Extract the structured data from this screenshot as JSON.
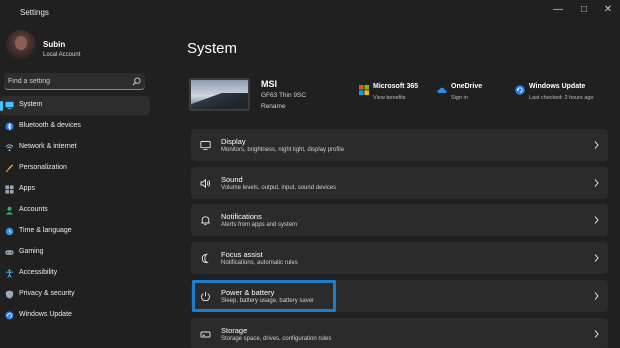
{
  "window": {
    "title": "Settings"
  },
  "user": {
    "name": "Subin",
    "account_type": "Local Account"
  },
  "search": {
    "placeholder": "Find a setting"
  },
  "sidebar": {
    "items": [
      {
        "label": "System",
        "icon": "monitor-icon",
        "active": true
      },
      {
        "label": "Bluetooth & devices",
        "icon": "bluetooth-icon"
      },
      {
        "label": "Network & internet",
        "icon": "wifi-icon"
      },
      {
        "label": "Personalization",
        "icon": "brush-icon"
      },
      {
        "label": "Apps",
        "icon": "apps-icon"
      },
      {
        "label": "Accounts",
        "icon": "person-icon"
      },
      {
        "label": "Time & language",
        "icon": "globe-clock-icon"
      },
      {
        "label": "Gaming",
        "icon": "gamepad-icon"
      },
      {
        "label": "Accessibility",
        "icon": "accessibility-icon"
      },
      {
        "label": "Privacy & security",
        "icon": "shield-icon"
      },
      {
        "label": "Windows Update",
        "icon": "update-icon"
      }
    ]
  },
  "main": {
    "title": "System",
    "device": {
      "name": "MSI",
      "model": "GF63 Thin 9SC",
      "rename_label": "Rename"
    },
    "quick_links": [
      {
        "title": "Microsoft 365",
        "subtitle": "View benefits",
        "icon": "microsoft-logo-icon"
      },
      {
        "title": "OneDrive",
        "subtitle": "Sign in",
        "icon": "onedrive-cloud-icon"
      },
      {
        "title": "Windows Update",
        "subtitle": "Last checked: 2 hours ago",
        "icon": "update-icon"
      }
    ],
    "cards": [
      {
        "title": "Display",
        "subtitle": "Monitors, brightness, night light, display profile",
        "icon": "display-icon"
      },
      {
        "title": "Sound",
        "subtitle": "Volume levels, output, input, sound devices",
        "icon": "speaker-icon"
      },
      {
        "title": "Notifications",
        "subtitle": "Alerts from apps and system",
        "icon": "bell-icon"
      },
      {
        "title": "Focus assist",
        "subtitle": "Notifications, automatic rules",
        "icon": "moon-icon"
      },
      {
        "title": "Power & battery",
        "subtitle": "Sleep, battery usage, battery saver",
        "icon": "power-icon"
      },
      {
        "title": "Storage",
        "subtitle": "Storage space, drives, configuration rules",
        "icon": "storage-icon"
      }
    ]
  },
  "colors": {
    "background": "#202020",
    "card": "#2b2b2b",
    "accent": "#4cc2ff",
    "highlight_box": "#1b7fd0"
  }
}
